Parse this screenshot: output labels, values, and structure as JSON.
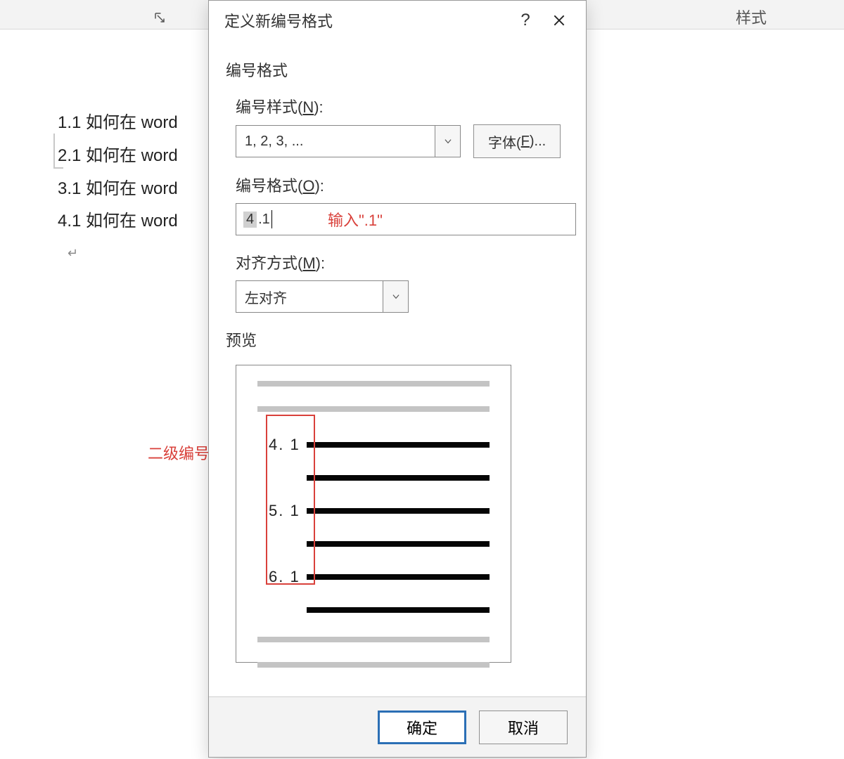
{
  "ribbon": {
    "styles_label": "样式"
  },
  "doc_lines": [
    "1.1 如何在 word",
    "2.1 如何在 word",
    "3.1 如何在 word",
    "4.1 如何在 word"
  ],
  "dialog": {
    "title": "定义新编号格式",
    "section_format": "编号格式",
    "label_style_pre": "编号样式(",
    "label_style_mn": "N",
    "label_style_post": "):",
    "style_value": "1, 2, 3, ...",
    "font_btn_pre": "字体(",
    "font_btn_mn": "F",
    "font_btn_post": ")...",
    "label_format_pre": "编号格式(",
    "label_format_mn": "O",
    "label_format_post": "):",
    "format_prefix": "4",
    "format_suffix": ".1",
    "annotation_input": "输入\".1\"",
    "label_align_pre": "对齐方式(",
    "label_align_mn": "M",
    "label_align_post": "):",
    "align_value": "左对齐",
    "section_preview": "预览",
    "preview_numbers": [
      "4. 1",
      "5. 1",
      "6. 1"
    ],
    "ok": "确定",
    "cancel": "取消"
  },
  "annotation_outside": "二级编号"
}
